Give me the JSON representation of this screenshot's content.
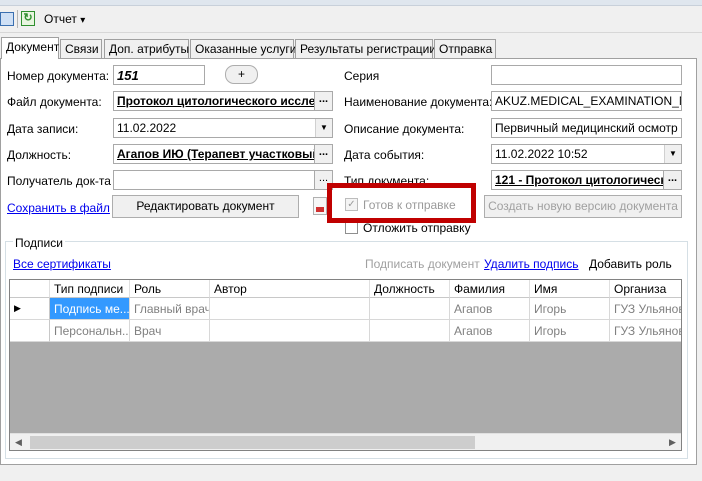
{
  "toolbar": {
    "save_icon": "save-icon",
    "refresh_icon": "refresh-icon",
    "report_label": "Отчет",
    "report_arrow": "▾"
  },
  "tabs": [
    {
      "label": "Документ",
      "active": true
    },
    {
      "label": "Связи",
      "active": false
    },
    {
      "label": "Доп. атрибуты",
      "active": false
    },
    {
      "label": "Оказанные услуги",
      "active": false
    },
    {
      "label": "Результаты регистрации",
      "active": false
    },
    {
      "label": "Отправка",
      "active": false
    }
  ],
  "form": {
    "doc_number_label": "Номер документа:",
    "doc_number_value": "151",
    "plus_label": "+",
    "doc_file_label": "Файл документа:",
    "doc_file_value": "Протокол цитологического исслед",
    "record_date_label": "Дата записи:",
    "record_date_value": "11.02.2022",
    "position_label": "Должность:",
    "position_value": "Агапов ИЮ (Терапевт участковый)",
    "recipient_label": "Получатель док-та",
    "recipient_value": "",
    "series_label": "Серия",
    "series_value": "",
    "doc_name_label": "Наименование документа:",
    "doc_name_value": "AKUZ.MEDICAL_EXAMINATION_MAII",
    "doc_desc_label": "Описание документа:",
    "doc_desc_value": "Первичный медицинский осмотр",
    "event_date_label": "Дата события:",
    "event_date_value": "11.02.2022 10:52",
    "doc_type_label": "Тип документа:",
    "doc_type_value": "121 - Протокол цитологическ",
    "ellipsis": "..."
  },
  "actions": {
    "save_to_file": "Сохранить в файл",
    "edit_document": "Редактировать документ",
    "ready_to_send": "Готов к отправке",
    "postpone_send": "Отложить отправку",
    "new_version": "Создать новую версию документа",
    "ready_checked": true,
    "postpone_checked": false
  },
  "signatures": {
    "group_label": "Подписи",
    "all_certificates": "Все сертификаты",
    "sign_document": "Подписать документ",
    "delete_signature": "Удалить подпись",
    "add_role": "Добавить роль",
    "columns": [
      "Тип подписи",
      "Роль",
      "Автор",
      "Должность",
      "Фамилия",
      "Имя",
      "Организа"
    ],
    "rows": [
      [
        "Подпись ме...",
        "Главный врач",
        "",
        "",
        "Агапов",
        "Игорь",
        "ГУЗ Ульянов"
      ],
      [
        "Персональн...",
        "Врач",
        "",
        "",
        "Агапов",
        "Игорь",
        "ГУЗ Ульянов"
      ]
    ],
    "current_row_marker": "▶"
  },
  "colors": {
    "highlight_box": "#c00000",
    "selection": "#3399ff",
    "link": "#0000ee"
  }
}
